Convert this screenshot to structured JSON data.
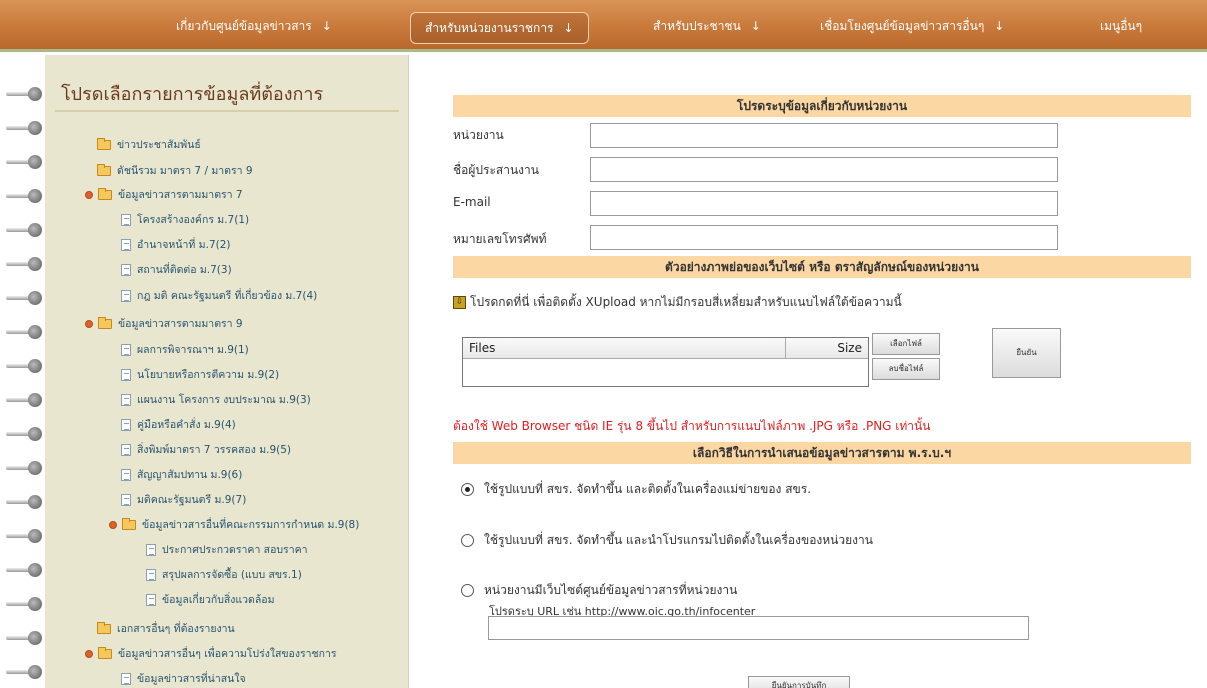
{
  "nav": {
    "items": [
      {
        "label": "เกี่ยวกับศูนย์ข้อมูลข่าวสาร",
        "arrow": "↓"
      },
      {
        "label": "สำหรับหน่วยงานราชการ",
        "arrow": "↓"
      },
      {
        "label": "สำหรับประชาชน",
        "arrow": "↓"
      },
      {
        "label": "เชื่อมโยงศูนย์ข้อมูลข่าวสารอื่นๆ",
        "arrow": "↓"
      },
      {
        "label": "เมนูอื่นๆ",
        "arrow": ""
      }
    ]
  },
  "sidebar": {
    "title": "โปรดเลือกรายการข้อมูลที่ต้องการ",
    "items": [
      {
        "label": "ข่าวประชาสัมพันธ์"
      },
      {
        "label": "ดัชนีรวม มาตรา 7 / มาตรา 9"
      },
      {
        "label": "ข้อมูลข่าวสารตามมาตรา 7"
      },
      {
        "label": "โครงสร้างองค์กร ม.7(1)"
      },
      {
        "label": "อำนาจหน้าที่ ม.7(2)"
      },
      {
        "label": "สถานที่ติดต่อ ม.7(3)"
      },
      {
        "label": "กฎ มติ คณะรัฐมนตรี ที่เกี่ยวข้อง ม.7(4)"
      },
      {
        "label": "ข้อมูลข่าวสารตามมาตรา 9"
      },
      {
        "label": "ผลการพิจารณาฯ ม.9(1)"
      },
      {
        "label": "นโยบายหรือการตีความ ม.9(2)"
      },
      {
        "label": "แผนงาน โครงการ งบประมาณ ม.9(3)"
      },
      {
        "label": "คู่มือหรือคำสั่ง ม.9(4)"
      },
      {
        "label": "สิ่งพิมพ์มาตรา 7 วรรคสอง ม.9(5)"
      },
      {
        "label": "สัญญาสัมปทาน ม.9(6)"
      },
      {
        "label": "มติคณะรัฐมนตรี ม.9(7)"
      },
      {
        "label": "ข้อมูลข่าวสารอื่นที่คณะกรรมการกำหนด ม.9(8)"
      },
      {
        "label": "ประกาศประกวดราคา สอบราคา"
      },
      {
        "label": "สรุปผลการจัดซื้อ (แบบ สขร.1)"
      },
      {
        "label": "ข้อมูลเกี่ยวกับสิ่งแวดล้อม"
      },
      {
        "label": "เอกสารอื่นๆ ที่ต้องรายงาน"
      },
      {
        "label": "ข้อมูลข่าวสารอื่นๆ เพื่อความโปร่งใสของราชการ"
      },
      {
        "label": "ข้อมูลข่าวสารที่น่าสนใจ"
      }
    ]
  },
  "form": {
    "section1_title": "โปรดระบุข้อมูลเกี่ยวกับหน่วยงาน",
    "fields": {
      "agency_label": "หน่วยงาน",
      "agency_value": "",
      "coordinator_label": "ชื่อผู้ประสานงาน",
      "coordinator_value": "",
      "email_label": "E-mail",
      "email_value": "",
      "phone_label": "หมายเลขโทรศัพท์",
      "phone_value": ""
    },
    "section2_title": "ตัวอย่างภาพย่อของเว็บไซต์ หรือ ตราสัญลักษณ์ของหน่วยงาน",
    "upload_note": "โปรดกดที่นี่ เพื่อติดตั้ง XUpload หากไม่มีกรอบสี่เหลี่ยมสำหรับแนบไฟล์ใต้ข้อความนี้",
    "files_header": "Files",
    "size_header": "Size",
    "choose_file_button": "เลือกไฟล์",
    "delete_file_button": "ลบชื่อไฟล์",
    "confirm_button": "ยืนยัน",
    "warning": "ต้องใช้ Web Browser ชนิด IE รุ่น 8 ขึ้นไป สำหรับการแนบไฟล์ภาพ .JPG หรือ .PNG เท่านั้น",
    "section3_title": "เลือกวิธีในการนำเสนอข้อมูลข่าวสารตาม พ.ร.บ.ฯ",
    "options": [
      {
        "label": "ใช้รูปแบบที่ สขร. จัดทำขึ้น และติดตั้งในเครื่องแม่ข่ายของ สขร.",
        "checked": true
      },
      {
        "label": "ใช้รูปแบบที่ สขร. จัดทำขึ้น และนำโปรแกรมไปติดตั้งในเครื่องของหน่วยงาน",
        "checked": false
      },
      {
        "label": "หน่วยงานมีเว็บไซต์ศูนย์ข้อมูลข่าวสารที่หน่วยงาน",
        "checked": false
      }
    ],
    "url_hint": "โปรดระบุ URL เช่น http://www.oic.go.th/infocenter",
    "url_value": "",
    "submit_button": "ยืนยันการบันทึก"
  }
}
